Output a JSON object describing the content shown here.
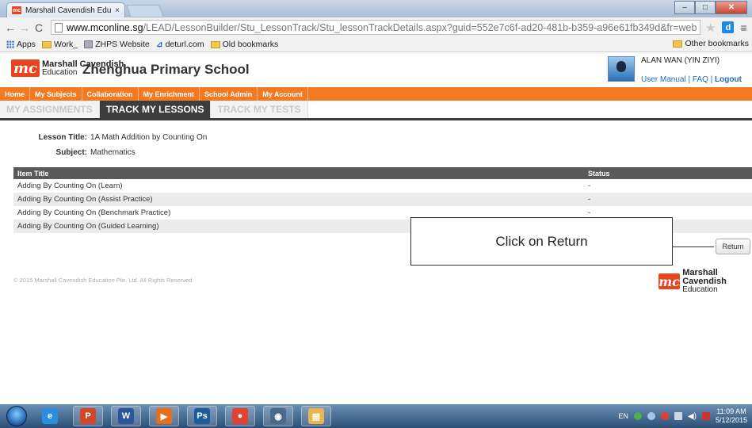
{
  "browser": {
    "tab_title": "Marshall Cavendish Educa",
    "tab_favicon": "mc",
    "tab_close": "×",
    "url_host": "www.mconline.sg",
    "url_path": "/LEAD/LessonBuilder/Stu_LessonTrack/Stu_lessonTrackDetails.aspx?guid=552e7c6f-ad20-481b-b359-a96e61fb349d&fr=web",
    "bookmarks": [
      {
        "label": "Apps",
        "icon": "apps-grid-icon"
      },
      {
        "label": "Work_",
        "icon": "folder-icon"
      },
      {
        "label": "ZHPS Website",
        "icon": "site-icon"
      },
      {
        "label": "deturl.com",
        "icon": "deturl-icon"
      },
      {
        "label": "Old bookmarks",
        "icon": "folder-icon"
      }
    ],
    "other_bookmarks": "Other bookmarks",
    "extension_letter": "d"
  },
  "site": {
    "logo_brand": "Marshall Cavendish",
    "logo_sub": "Education",
    "logo_badge": "mc",
    "school_name": "Zhenghua Primary School",
    "user_name": "ALAN WAN (YIN ZIYI)",
    "user_links": [
      "User Manual",
      "FAQ",
      "Logout"
    ],
    "user_link_sep": " | "
  },
  "top_nav": [
    "Home",
    "My Subjects",
    "Collaboration",
    "My Enrichment",
    "School Admin",
    "My Account"
  ],
  "sub_tabs": [
    {
      "label": "MY ASSIGNMENTS",
      "active": false
    },
    {
      "label": "TRACK MY LESSONS",
      "active": true
    },
    {
      "label": "TRACK MY TESTS",
      "active": false
    }
  ],
  "lesson": {
    "title_label": "Lesson Title:",
    "title_value": "1A Math Addition by Counting On",
    "subject_label": "Subject:",
    "subject_value": "Mathematics"
  },
  "table": {
    "headers": [
      "Item Title",
      "Status"
    ],
    "rows": [
      {
        "title": "Adding By Counting On (Learn)",
        "status": "-"
      },
      {
        "title": "Adding By Counting On (Assist Practice)",
        "status": "-"
      },
      {
        "title": "Adding By Counting On (Benchmark Practice)",
        "status": "-"
      },
      {
        "title": "Adding By Counting On (Guided Learning)",
        "status": ""
      }
    ]
  },
  "callout_text": "Click on Return",
  "return_label": "Return",
  "copyright": "© 2015 Marshall Cavendish Education Pte. Ltd. All Rights Reserved",
  "taskbar": {
    "language": "EN",
    "time": "11:09 AM",
    "date": "5/12/2015",
    "apps": [
      {
        "name": "ie-icon",
        "color": "#2b8fe0",
        "glyph": "e"
      },
      {
        "name": "powerpoint-icon",
        "color": "#d24726",
        "glyph": "P"
      },
      {
        "name": "word-icon",
        "color": "#2b579a",
        "glyph": "W"
      },
      {
        "name": "media-player-icon",
        "color": "#e56f1a",
        "glyph": "▶"
      },
      {
        "name": "photoshop-icon",
        "color": "#1d5d9b",
        "glyph": "Ps"
      },
      {
        "name": "chrome-icon",
        "color": "#e34133",
        "glyph": "●"
      },
      {
        "name": "camera-icon",
        "color": "#4b6a8a",
        "glyph": "◉"
      },
      {
        "name": "explorer-icon",
        "color": "#e6b84b",
        "glyph": "▤"
      }
    ]
  }
}
